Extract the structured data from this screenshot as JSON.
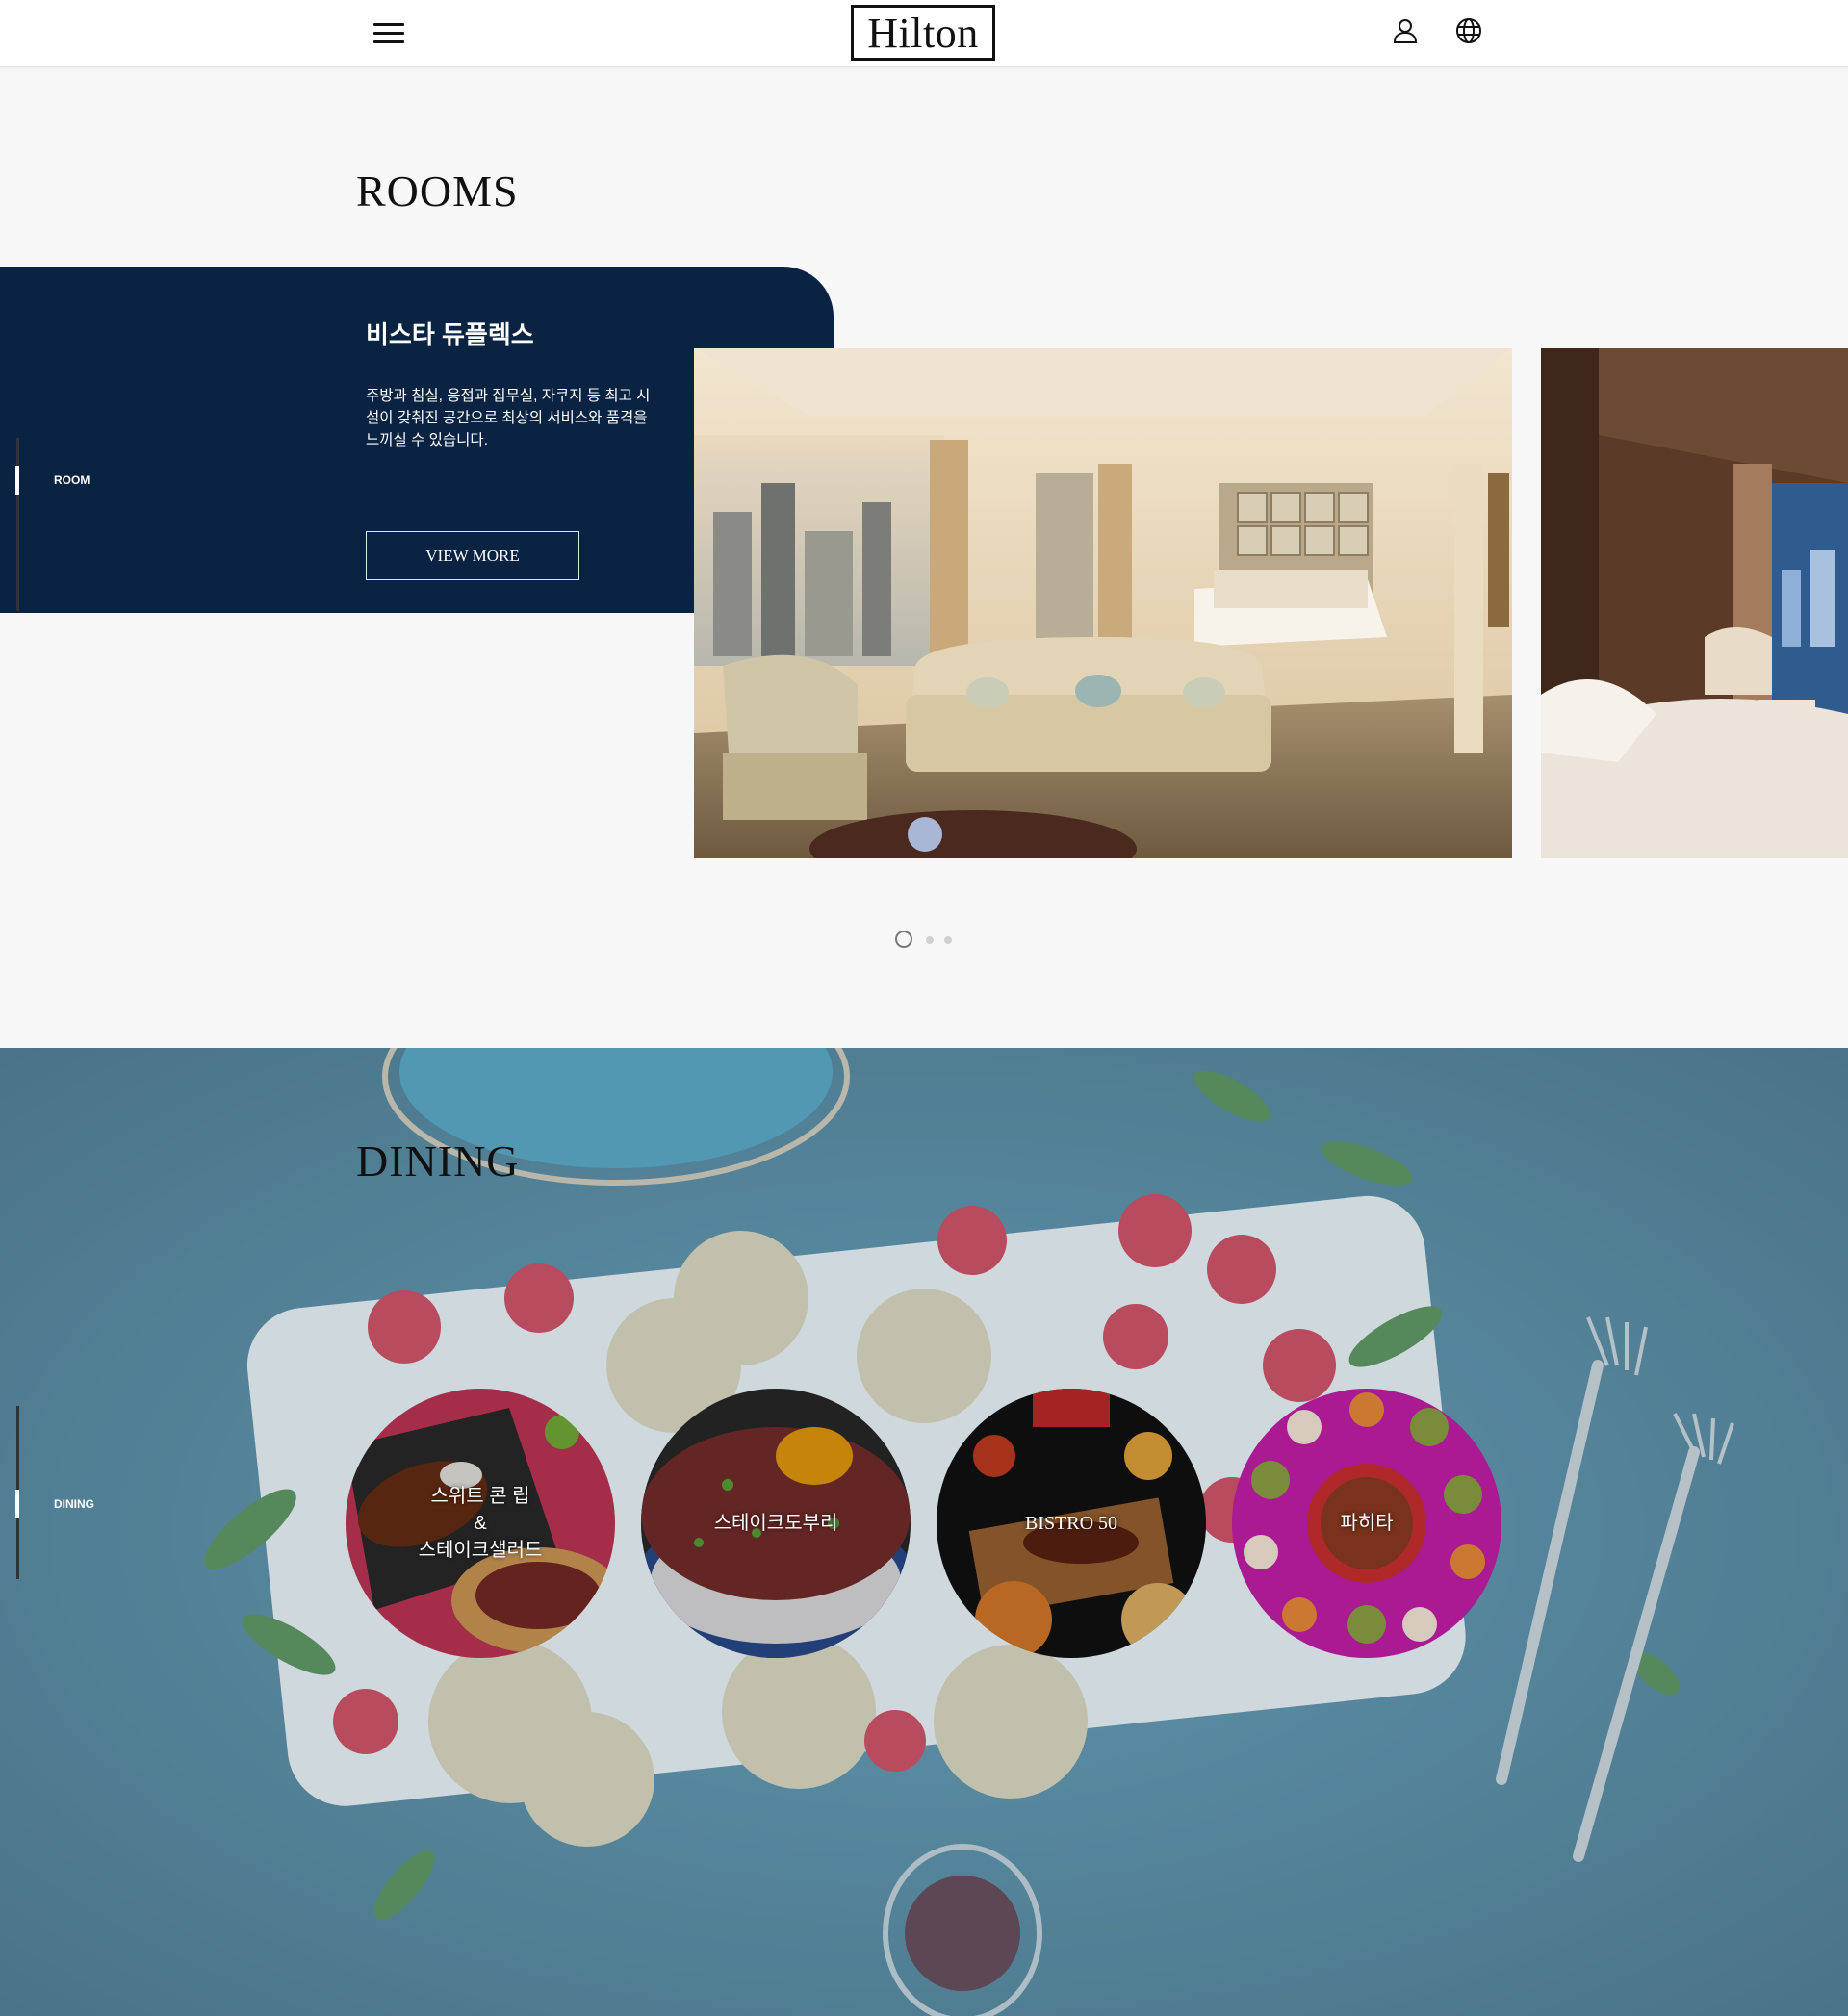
{
  "header": {
    "logo": "Hilton",
    "menu_icon": "hamburger-menu-icon",
    "user_icon": "user-icon",
    "language_icon": "globe-icon"
  },
  "rooms": {
    "title": "ROOMS",
    "side_label": "ROOM",
    "card": {
      "name": "비스타 듀플렉스",
      "description": "주방과 침실, 응접과 집무실, 자쿠지 등 최고 시설이 갖춰진 공간으로 최상의 서비스와 품격을 느끼실 수 있습니다.",
      "button_label": "VIEW MORE"
    },
    "pagination": {
      "total": 3,
      "active": 1
    }
  },
  "dining": {
    "title": "DINING",
    "side_label": "DINING",
    "items": [
      {
        "label": "스위트 콘 립\n&\n스테이크샐러드"
      },
      {
        "label": "스테이크도부리"
      },
      {
        "label": "BISTRO 50"
      },
      {
        "label": "파히타"
      }
    ]
  },
  "colors": {
    "navy": "#0a2343",
    "page_bg": "#f7f7f7",
    "dining_bg": "#3f6f86"
  }
}
